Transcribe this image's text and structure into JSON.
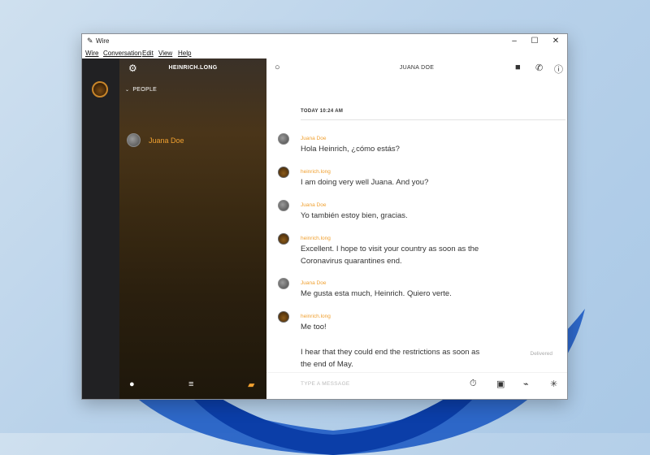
{
  "window": {
    "title": "Wire",
    "app_icon": "wire-logo-icon"
  },
  "window_controls": {
    "minimize": "–",
    "maximize": "☐",
    "close": "✕"
  },
  "menu": [
    "Wire",
    "Conversation",
    "Edit",
    "View",
    "Help"
  ],
  "sidebar": {
    "user_handle": "HEINRICH.LONG",
    "section_label": "PEOPLE",
    "contacts": [
      {
        "name": "Juana Doe"
      }
    ]
  },
  "conversation": {
    "title": "JUANA DOE",
    "timestamp": "TODAY 10:24 AM",
    "messages": [
      {
        "author": "Juana Doe",
        "text": "Hola Heinrich, ¿cómo estás?"
      },
      {
        "author": "heinrich.long",
        "text": "I am doing very well Juana. And you?"
      },
      {
        "author": "Juana Doe",
        "text": "Yo también estoy bien, gracias."
      },
      {
        "author": "heinrich.long",
        "text": "Excellent. I hope to visit your country as soon as the Coronavirus quarantines end."
      },
      {
        "author": "Juana Doe",
        "text": "Me gusta esta much, Heinrich. Quiero verte."
      },
      {
        "author": "heinrich.long",
        "text": "Me too!",
        "text2": "I hear that they could end the restrictions as soon as the end of May.",
        "status": "Delivered"
      }
    ],
    "compose_placeholder": "TYPE A MESSAGE"
  },
  "colors": {
    "accent": "#f0a030",
    "rail": "#212123",
    "sidebar": "#3a2a12"
  }
}
